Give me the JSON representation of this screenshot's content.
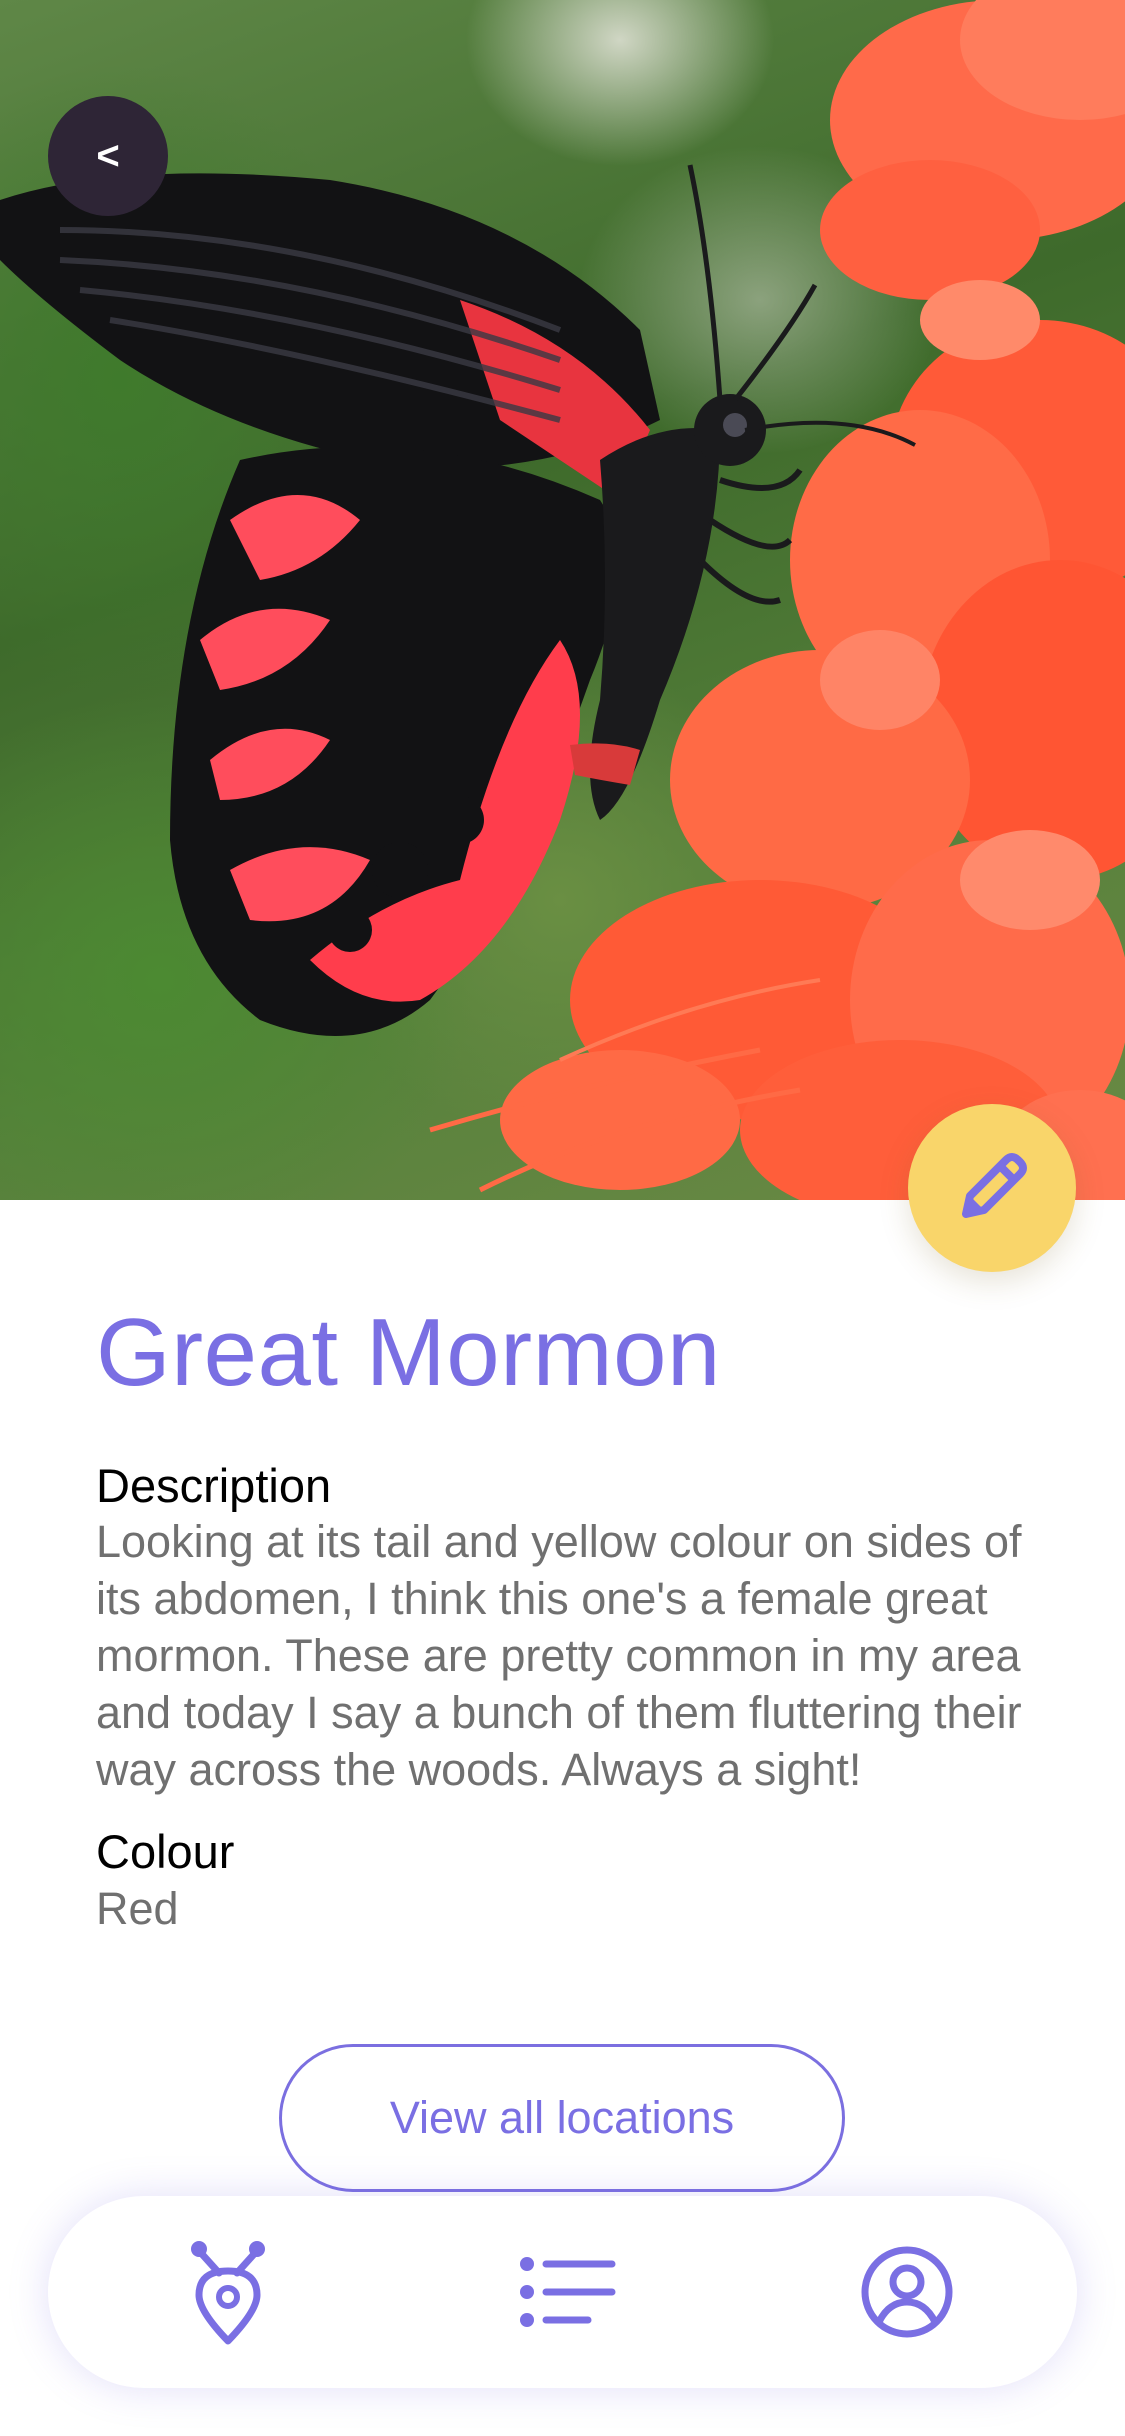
{
  "header": {
    "back_label": "<",
    "back_icon": "chevron-left-icon",
    "edit_icon": "pencil-icon",
    "photo_subject": "butterfly-photo"
  },
  "species": {
    "name": "Great Mormon",
    "description_label": "Description",
    "description": "Looking at its tail and yellow colour on sides of its abdomen, I think this one's a female great mormon. These are pretty common in my area and today I say a bunch of them fluttering their way across the woods. Always a sight!",
    "colour_label": "Colour",
    "colour": "Red"
  },
  "actions": {
    "view_locations_label": "View all locations"
  },
  "bottom_nav": {
    "items": [
      {
        "icon": "butterfly-map-pin-icon",
        "active": false
      },
      {
        "icon": "list-icon",
        "active": false
      },
      {
        "icon": "user-profile-icon",
        "active": false
      }
    ]
  },
  "colors": {
    "accent": "#7a6fe3",
    "fab": "#f9d56a",
    "back_button": "#2e2536",
    "body_text": "#707070"
  }
}
